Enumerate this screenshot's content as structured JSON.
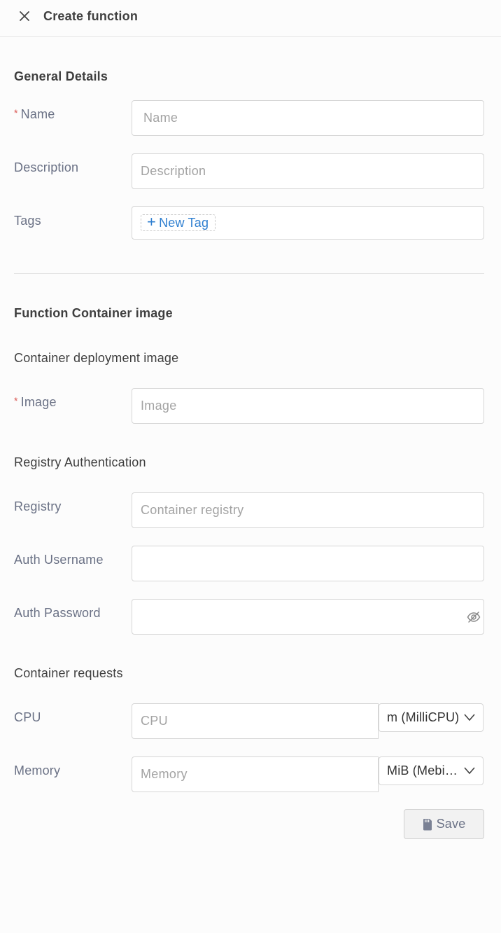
{
  "header": {
    "title": "Create function",
    "close_icon": "close-icon"
  },
  "general": {
    "title": "General Details",
    "name": {
      "label": "Name",
      "required_mark": "*",
      "placeholder": "Name",
      "value": ""
    },
    "description": {
      "label": "Description",
      "placeholder": "Description",
      "value": ""
    },
    "tags": {
      "label": "Tags",
      "new_tag_label": "New Tag",
      "new_tag_icon": "plus-icon"
    }
  },
  "container": {
    "title": "Function Container image",
    "deployment_title": "Container deployment image",
    "image": {
      "label": "Image",
      "required_mark": "*",
      "placeholder": "Image",
      "value": ""
    },
    "registry_auth_title": "Registry Authentication",
    "registry": {
      "label": "Registry",
      "placeholder": "Container registry",
      "value": ""
    },
    "auth_username": {
      "label": "Auth Username",
      "placeholder": "",
      "value": ""
    },
    "auth_password": {
      "label": "Auth Password",
      "placeholder": "",
      "value": "",
      "toggle_icon": "eye-slash-icon"
    },
    "requests_title": "Container requests",
    "cpu": {
      "label": "CPU",
      "placeholder": "CPU",
      "value": "",
      "unit": "m (MilliCPU)"
    },
    "memory": {
      "label": "Memory",
      "placeholder": "Memory",
      "value": "",
      "unit": "MiB (Mebibytes)"
    }
  },
  "actions": {
    "save_label": "Save",
    "save_icon": "floppy-disk-icon"
  },
  "colors": {
    "required": "#d9534f",
    "link": "#2f7fd0",
    "label": "#6a7185",
    "border": "#d6d6d6"
  }
}
